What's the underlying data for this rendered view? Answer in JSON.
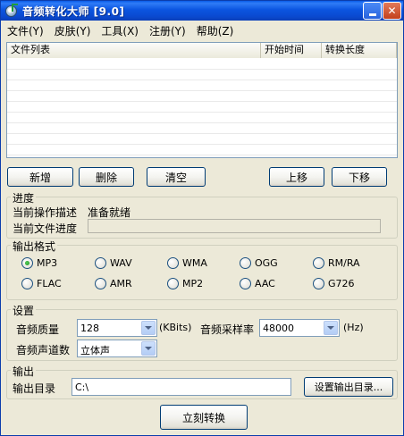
{
  "window": {
    "title": "音频转化大师 [9.0]",
    "minimize_glyph": "_",
    "close_glyph": "✕"
  },
  "menu": [
    "文件(Y)",
    "皮肤(Y)",
    "工具(X)",
    "注册(Y)",
    "帮助(Z)"
  ],
  "file_list": {
    "columns": [
      "文件列表",
      "开始时间",
      "转换长度"
    ],
    "rows": []
  },
  "list_buttons": {
    "add": "新增",
    "delete": "删除",
    "clear": "清空",
    "move_up": "上移",
    "move_down": "下移"
  },
  "progress": {
    "group_title": "进度",
    "current_op_label": "当前操作描述",
    "current_op_value": "准备就绪",
    "current_file_label": "当前文件进度",
    "current_file_progress": 0
  },
  "output_format": {
    "group_title": "输出格式",
    "options": [
      "MP3",
      "WAV",
      "WMA",
      "OGG",
      "RM/RA",
      "FLAC",
      "AMR",
      "MP2",
      "AAC",
      "G726"
    ],
    "selected": "MP3"
  },
  "settings": {
    "group_title": "设置",
    "quality_label": "音频质量",
    "quality_value": "128",
    "quality_unit": "(KBits)",
    "sample_rate_label": "音频采样率",
    "sample_rate_value": "48000",
    "sample_rate_unit": "(Hz)",
    "channels_label": "音频声道数",
    "channels_value": "立体声"
  },
  "output": {
    "group_title": "输出",
    "dir_label": "输出目录",
    "dir_value": "C:\\",
    "set_dir_button": "设置输出目录..."
  },
  "convert_button": "立刻转换",
  "colors": {
    "titlebar": "#0a55e0",
    "face": "#ece9d8",
    "button_border": "#003c74",
    "radio_check": "#1b8d22"
  }
}
